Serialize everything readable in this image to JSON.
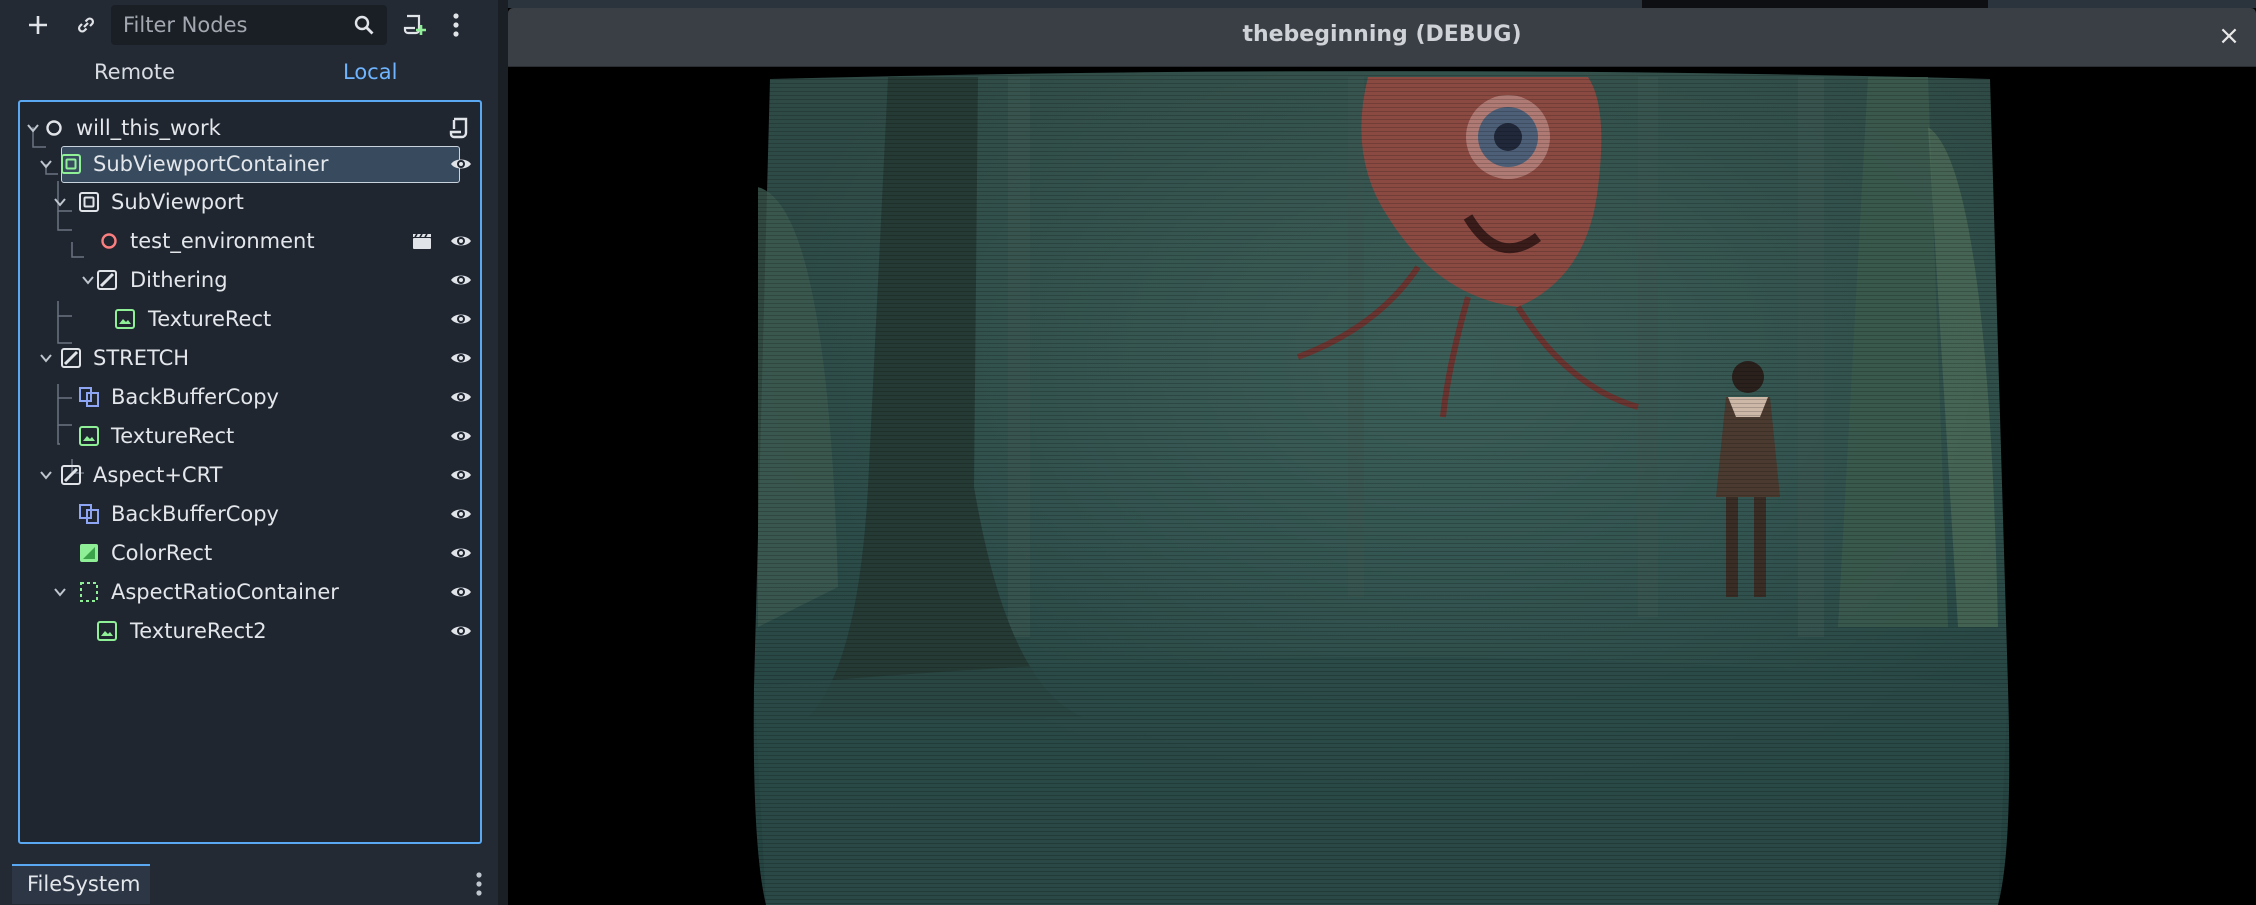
{
  "toolbar": {
    "add_icon": "plus-icon",
    "link_icon": "link-icon",
    "filter_placeholder": "Filter Nodes",
    "search_icon": "search-icon",
    "scene_add_icon": "add-script-icon",
    "menu_icon": "kebab-menu-icon"
  },
  "tabs": {
    "remote": "Remote",
    "local": "Local"
  },
  "tree": {
    "nodes": [
      {
        "label": "will_this_work",
        "type": "Node3D",
        "depth": 0
      },
      {
        "label": "SubViewportContainer",
        "type": "SubViewportContainer",
        "depth": 1,
        "selected": true
      },
      {
        "label": "SubViewport",
        "type": "SubViewport",
        "depth": 2
      },
      {
        "label": "test_environment",
        "type": "Node3D-instance",
        "depth": 3
      },
      {
        "label": "Dithering",
        "type": "CanvasLayer",
        "depth": 3
      },
      {
        "label": "TextureRect",
        "type": "TextureRect",
        "depth": 4
      },
      {
        "label": "STRETCH",
        "type": "CanvasLayer",
        "depth": 2
      },
      {
        "label": "BackBufferCopy",
        "type": "BackBufferCopy",
        "depth": 3
      },
      {
        "label": "TextureRect",
        "type": "TextureRect",
        "depth": 3
      },
      {
        "label": "Aspect+CRT",
        "type": "CanvasLayer",
        "depth": 2
      },
      {
        "label": "BackBufferCopy",
        "type": "BackBufferCopy",
        "depth": 3
      },
      {
        "label": "ColorRect",
        "type": "ColorRect",
        "depth": 3
      },
      {
        "label": "AspectRatioContainer",
        "type": "AspectRatioContainer",
        "depth": 3
      },
      {
        "label": "TextureRect2",
        "type": "TextureRect",
        "depth": 4
      }
    ]
  },
  "filesystem": {
    "tab_label": "FileSystem",
    "menu_icon": "kebab-menu-icon"
  },
  "game_window": {
    "title": "thebeginning (DEBUG)",
    "close_label": "×",
    "scene_icon": "game-scene-viewport"
  },
  "colors": {
    "accent": "#5aa7f2",
    "selection": "#374a5e",
    "node_green": "#8eef97",
    "node_red": "#fc7f7f",
    "node_blue": "#8da5f3"
  }
}
